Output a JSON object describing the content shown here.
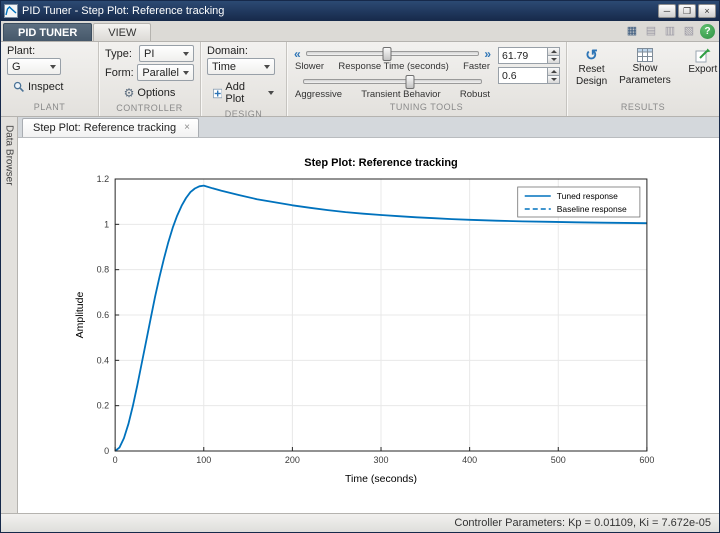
{
  "window": {
    "title": "PID Tuner - Step Plot: Reference tracking",
    "controls": {
      "minimize": "─",
      "maximize": "❐",
      "close": "×"
    }
  },
  "ribbon_tabs": {
    "pid_tuner": "PID TUNER",
    "view": "VIEW"
  },
  "quick_access": {
    "icons": [
      {
        "name": "figure-tools-icon",
        "glyph": "▦"
      },
      {
        "name": "print-icon",
        "glyph": "▤"
      },
      {
        "name": "layout-icon",
        "glyph": "▥"
      },
      {
        "name": "dock-icon",
        "glyph": "▧"
      }
    ],
    "help": "?"
  },
  "plant": {
    "section_label": "PLANT",
    "field_label": "Plant:",
    "value": "G",
    "inspect_label": "Inspect"
  },
  "controller": {
    "section_label": "CONTROLLER",
    "type_label": "Type:",
    "type_value": "PI",
    "form_label": "Form:",
    "form_value": "Parallel",
    "options_icon": "⚙",
    "options_label": "Options"
  },
  "design": {
    "section_label": "DESIGN",
    "domain_label": "Domain:",
    "domain_value": "Time",
    "add_plot_label": "Add Plot"
  },
  "tuning": {
    "section_label": "TUNING TOOLS",
    "nav_left": "«",
    "nav_right": "»",
    "slider1": {
      "left": "Slower",
      "center": "Response Time (seconds)",
      "right": "Faster",
      "value": "61.79",
      "position_pct": 47
    },
    "slider2": {
      "left": "Aggressive",
      "center": "Transient Behavior",
      "right": "Robust",
      "value": "0.6",
      "position_pct": 60
    }
  },
  "results": {
    "section_label": "RESULTS",
    "reset_icon": "↺",
    "reset_label": "Reset Design",
    "show_label": "Show Parameters",
    "export_label": "Export"
  },
  "data_browser": {
    "label": "Data Browser"
  },
  "document_tab": {
    "label": "Step Plot: Reference tracking",
    "close": "×"
  },
  "status_bar": {
    "text": "Controller Parameters: Kp = 0.01109, Ki = 7.672e-05"
  },
  "chart_data": {
    "type": "line",
    "title": "Step Plot: Reference tracking",
    "xlabel": "Time (seconds)",
    "ylabel": "Amplitude",
    "xlim": [
      0,
      600
    ],
    "ylim": [
      0,
      1.2
    ],
    "xticks": [
      0,
      100,
      200,
      300,
      400,
      500,
      600
    ],
    "yticks": [
      0,
      0.2,
      0.4,
      0.6,
      0.8,
      1,
      1.2
    ],
    "grid": true,
    "legend_position": "top-right",
    "series": [
      {
        "name": "Tuned response",
        "style": "solid",
        "color": "#0072BD",
        "x": [
          0,
          5,
          10,
          15,
          20,
          25,
          30,
          35,
          40,
          45,
          50,
          55,
          60,
          65,
          70,
          75,
          80,
          85,
          90,
          95,
          100,
          110,
          120,
          140,
          160,
          180,
          200,
          220,
          240,
          260,
          280,
          300,
          320,
          340,
          360,
          380,
          400,
          430,
          460,
          490,
          520,
          550,
          600
        ],
        "y": [
          0,
          0.016,
          0.057,
          0.12,
          0.199,
          0.289,
          0.386,
          0.485,
          0.583,
          0.679,
          0.768,
          0.848,
          0.921,
          0.985,
          1.038,
          1.082,
          1.116,
          1.142,
          1.158,
          1.168,
          1.171,
          1.159,
          1.148,
          1.129,
          1.111,
          1.097,
          1.084,
          1.073,
          1.063,
          1.054,
          1.047,
          1.041,
          1.036,
          1.031,
          1.027,
          1.023,
          1.02,
          1.016,
          1.013,
          1.011,
          1.009,
          1.007,
          1.005
        ]
      },
      {
        "name": "Baseline response",
        "style": "dashed",
        "color": "#0072BD",
        "x": [],
        "y": []
      }
    ]
  }
}
